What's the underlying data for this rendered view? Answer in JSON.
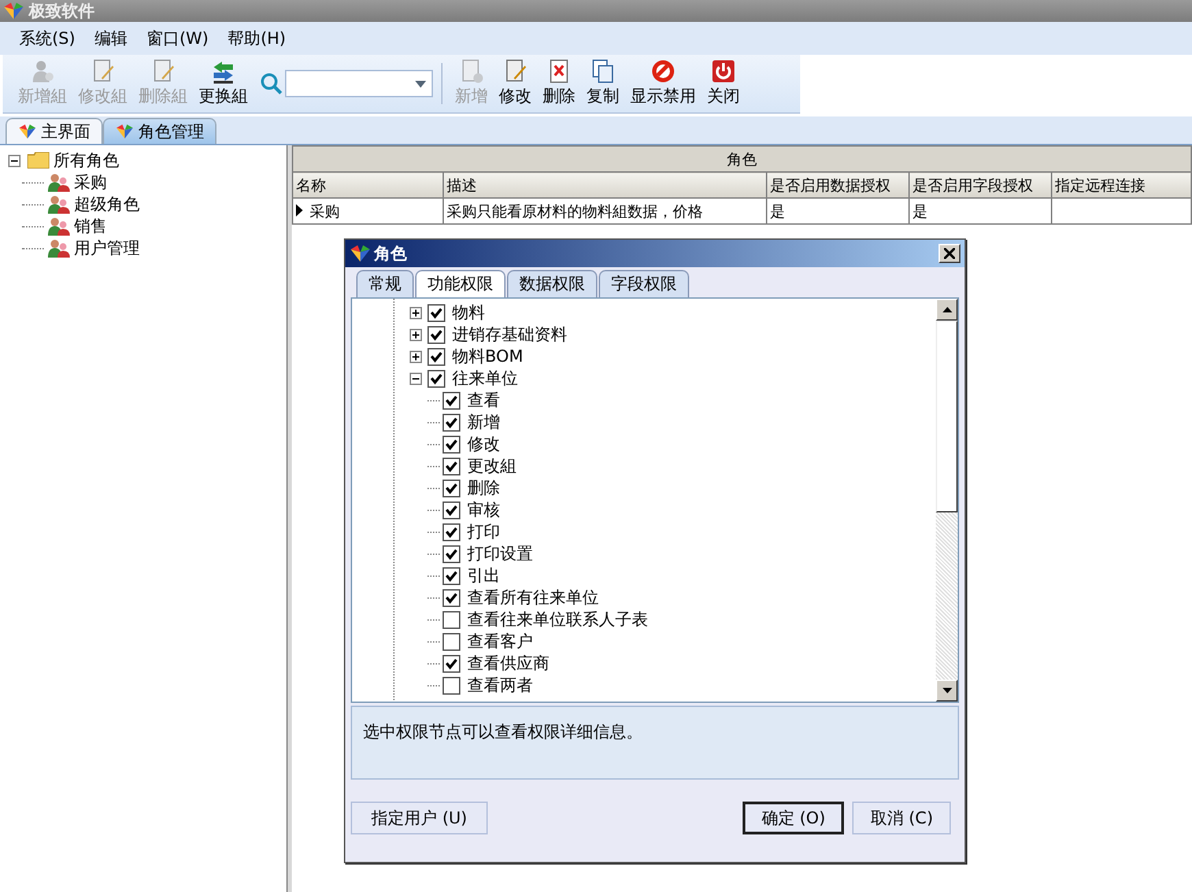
{
  "window": {
    "title": "极致软件"
  },
  "menu": [
    {
      "label": "系统(S)"
    },
    {
      "label": "编辑"
    },
    {
      "label": "窗口(W)"
    },
    {
      "label": "帮助(H)"
    }
  ],
  "toolbar": [
    {
      "kind": "addgroup",
      "label": "新增組",
      "disabled": true
    },
    {
      "kind": "editgroup",
      "label": "修改組",
      "disabled": true
    },
    {
      "kind": "delgroup",
      "label": "删除組",
      "disabled": true
    },
    {
      "kind": "swapgroup",
      "label": "更换組",
      "disabled": false
    },
    {
      "kind": "search"
    },
    {
      "kind": "new",
      "label": "新增",
      "disabled": true
    },
    {
      "kind": "edit",
      "label": "修改",
      "disabled": false
    },
    {
      "kind": "delete",
      "label": "删除",
      "disabled": false
    },
    {
      "kind": "copy",
      "label": "复制",
      "disabled": false
    },
    {
      "kind": "ban",
      "label": "显示禁用",
      "disabled": false
    },
    {
      "kind": "power",
      "label": "关闭",
      "disabled": false
    }
  ],
  "tabs": [
    {
      "label": "主界面",
      "selected": false
    },
    {
      "label": "角色管理",
      "selected": true
    }
  ],
  "role_tree": {
    "label": "所有角色",
    "expanded": true,
    "children": [
      {
        "label": "采购"
      },
      {
        "label": "超级角色"
      },
      {
        "label": "销售"
      },
      {
        "label": "用户管理"
      }
    ]
  },
  "grid": {
    "group_header": "角色",
    "columns": [
      "名称",
      "描述",
      "是否启用数据授权",
      "是否启用字段授权",
      "指定远程连接"
    ],
    "rows": [
      {
        "current": true,
        "cells": [
          "采购",
          "采购只能看原材料的物料組数据，价格",
          "是",
          "是"
        ]
      }
    ]
  },
  "dialog": {
    "title": "角色",
    "tabs": [
      {
        "label": "常规",
        "selected": false
      },
      {
        "label": "功能权限",
        "selected": true
      },
      {
        "label": "数据权限",
        "selected": false
      },
      {
        "label": "字段权限",
        "selected": false
      }
    ],
    "tree": [
      {
        "label": "物料",
        "checked": true,
        "expanded": false
      },
      {
        "label": "进销存基础资料",
        "checked": true,
        "expanded": false
      },
      {
        "label": "物料BOM",
        "checked": true,
        "expanded": false
      },
      {
        "label": "往来单位",
        "checked": true,
        "expanded": true,
        "children": [
          {
            "label": "查看",
            "checked": true
          },
          {
            "label": "新增",
            "checked": true
          },
          {
            "label": "修改",
            "checked": true
          },
          {
            "label": "更改組",
            "checked": true
          },
          {
            "label": "删除",
            "checked": true
          },
          {
            "label": "审核",
            "checked": true
          },
          {
            "label": "打印",
            "checked": true
          },
          {
            "label": "打印设置",
            "checked": true
          },
          {
            "label": "引出",
            "checked": true
          },
          {
            "label": "查看所有往来单位",
            "checked": true
          },
          {
            "label": "查看往来单位联系人子表",
            "checked": false
          },
          {
            "label": "查看客户",
            "checked": false
          },
          {
            "label": "查看供应商",
            "checked": true
          },
          {
            "label": "查看两者",
            "checked": false
          }
        ]
      }
    ],
    "info": "选中权限节点可以查看权限详细信息。",
    "buttons": [
      {
        "label": "指定用户 (U)",
        "default": false
      },
      {
        "label": "确定 (O)",
        "default": true
      },
      {
        "label": "取消 (C)",
        "default": false
      }
    ]
  }
}
